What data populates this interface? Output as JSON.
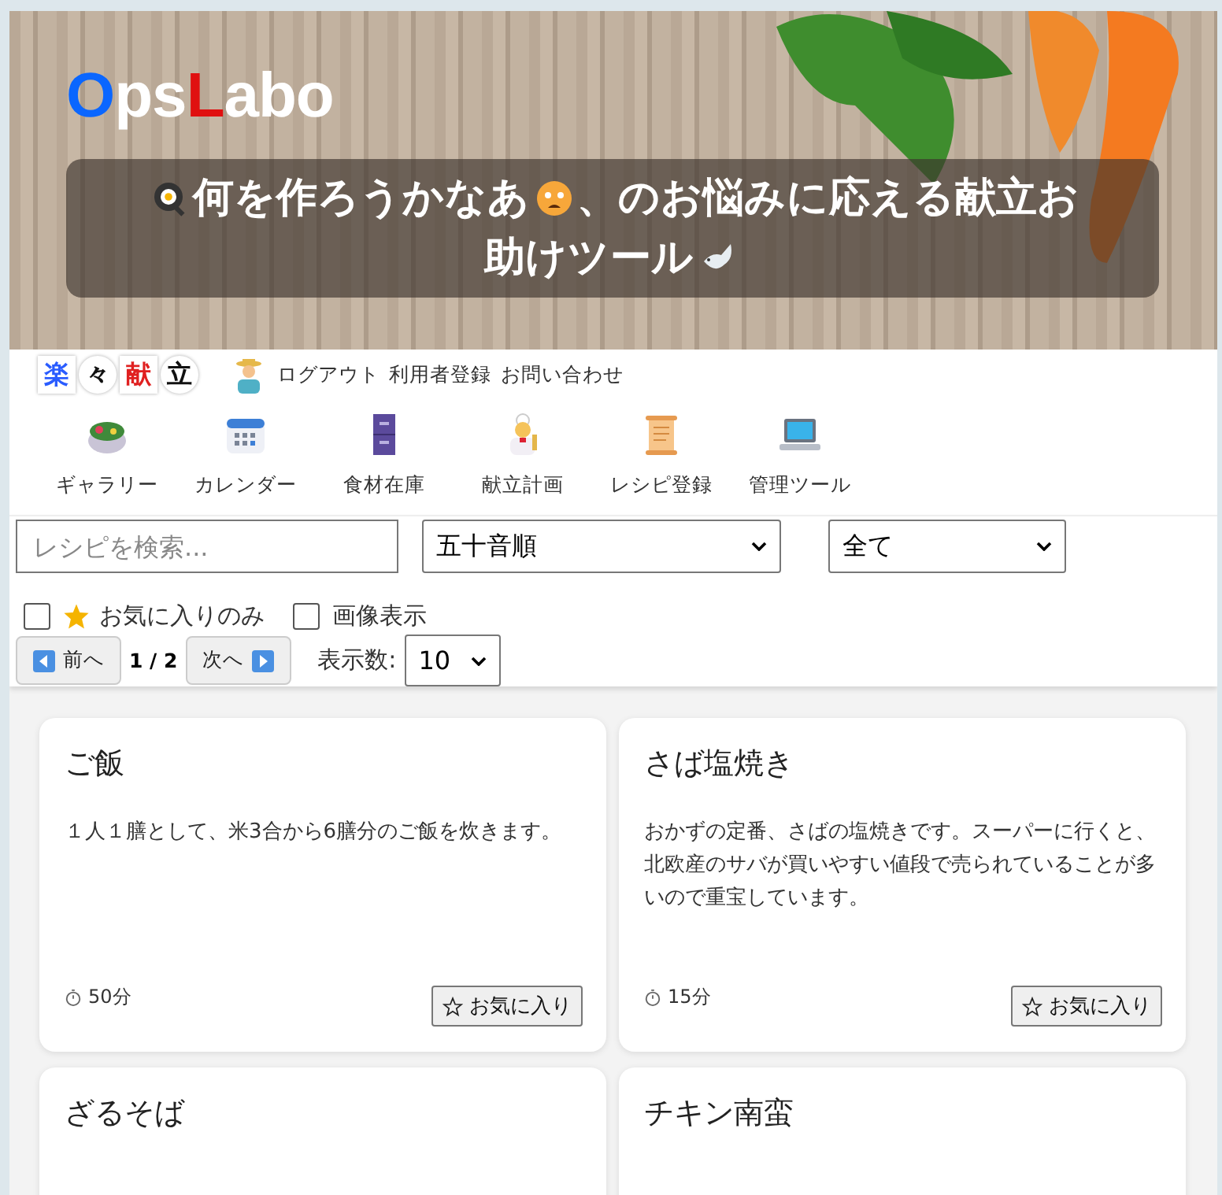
{
  "banner": {
    "logo": [
      {
        "text": "O",
        "color": "#0a66ff"
      },
      {
        "text": "ps",
        "color": "#ffffff"
      },
      {
        "text": "L",
        "color": "#e01010"
      },
      {
        "text": "abo",
        "color": "#ffffff"
      }
    ],
    "caption_parts": [
      "何を作ろうかなあ",
      "、のお悩みに応える献立お",
      "助けツール"
    ]
  },
  "app_logo": [
    {
      "text": "楽",
      "color": "#2a5cff"
    },
    {
      "text": "々",
      "color": "#111111"
    },
    {
      "text": "献",
      "color": "#e02020"
    },
    {
      "text": "立",
      "color": "#111111"
    }
  ],
  "user_links": [
    "ログアウト",
    "利用者登録",
    "お問い合わせ"
  ],
  "nav": [
    {
      "label": "ギャラリー",
      "kind": "salad"
    },
    {
      "label": "カレンダー",
      "kind": "calendar"
    },
    {
      "label": "食材在庫",
      "kind": "cabinet"
    },
    {
      "label": "献立計画",
      "kind": "cook"
    },
    {
      "label": "レシピ登録",
      "kind": "scroll"
    },
    {
      "label": "管理ツール",
      "kind": "laptop"
    }
  ],
  "search": {
    "placeholder": "レシピを検索..."
  },
  "sort": {
    "value": "五十音順"
  },
  "category": {
    "value": "全て"
  },
  "filters": [
    {
      "label": "お気に入りのみ",
      "checked": false,
      "kind": "star"
    },
    {
      "label": "画像表示",
      "checked": false,
      "kind": "plain"
    }
  ],
  "pager": {
    "prev": "前へ",
    "page": "1 / 2",
    "next": "次へ",
    "count_label": "表示数:",
    "count": "10"
  },
  "recipes": [
    {
      "title": "ご飯",
      "description": "１人１膳として、米3合から6膳分のご飯を炊きます。",
      "time": "50分",
      "favorite_label": "お気に入り",
      "favorite": false
    },
    {
      "title": "さば塩焼き",
      "description": "おかずの定番、さばの塩焼きです。スーパーに行くと、北欧産のサバが買いやすい値段で売られていることが多いので重宝しています。",
      "time": "15分",
      "favorite_label": "お気に入り",
      "favorite": false
    },
    {
      "title": "ざるそば"
    },
    {
      "title": "チキン南蛮"
    }
  ]
}
